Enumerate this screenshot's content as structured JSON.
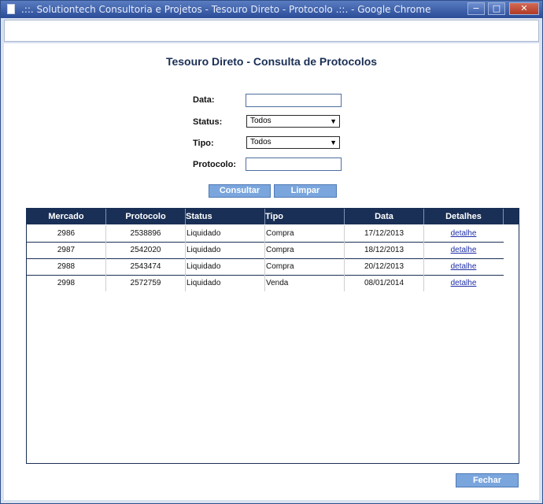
{
  "window": {
    "title": ".::. Solutiontech Consultoria e Projetos - Tesouro Direto - Protocolo .::. - Google Chrome",
    "minimize": "−",
    "maximize": "□",
    "close": "✕"
  },
  "page": {
    "heading": "Tesouro Direto - Consulta de Protocolos"
  },
  "form": {
    "data_label": "Data:",
    "data_value": "",
    "status_label": "Status:",
    "status_value": "Todos",
    "tipo_label": "Tipo:",
    "tipo_value": "Todos",
    "protocolo_label": "Protocolo:",
    "protocolo_value": "",
    "consultar": "Consultar",
    "limpar": "Limpar"
  },
  "table": {
    "headers": [
      "Mercado",
      "Protocolo",
      "Status",
      "Tipo",
      "Data",
      "Detalhes"
    ],
    "rows": [
      {
        "mercado": "2986",
        "protocolo": "2538896",
        "status": "Liquidado",
        "tipo": "Compra",
        "data": "17/12/2013",
        "detalhes": "detalhe"
      },
      {
        "mercado": "2987",
        "protocolo": "2542020",
        "status": "Liquidado",
        "tipo": "Compra",
        "data": "18/12/2013",
        "detalhes": "detalhe"
      },
      {
        "mercado": "2988",
        "protocolo": "2543474",
        "status": "Liquidado",
        "tipo": "Compra",
        "data": "20/12/2013",
        "detalhes": "detalhe"
      },
      {
        "mercado": "2998",
        "protocolo": "2572759",
        "status": "Liquidado",
        "tipo": "Venda",
        "data": "08/01/2014",
        "detalhes": "detalhe"
      }
    ]
  },
  "footer": {
    "fechar": "Fechar"
  },
  "colors": {
    "header_bg": "#1a2f55",
    "button_bg": "#7aa6dd",
    "link": "#1f2fa6"
  }
}
